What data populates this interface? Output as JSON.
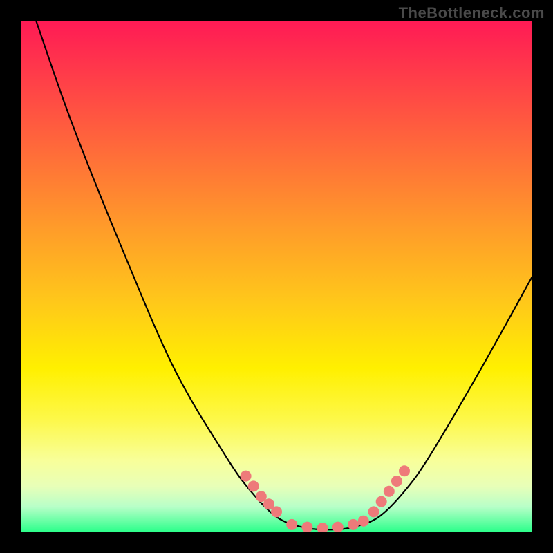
{
  "watermark": "TheBottleneck.com",
  "chart_data": {
    "type": "line",
    "title": "",
    "xlabel": "",
    "ylabel": "",
    "x_range": [
      0,
      100
    ],
    "y_range": [
      0,
      100
    ],
    "curve": {
      "name": "bottleneck-curve",
      "points": [
        {
          "x": 3,
          "y": 100
        },
        {
          "x": 10,
          "y": 80
        },
        {
          "x": 20,
          "y": 55
        },
        {
          "x": 30,
          "y": 32
        },
        {
          "x": 40,
          "y": 15
        },
        {
          "x": 45,
          "y": 8
        },
        {
          "x": 50,
          "y": 3
        },
        {
          "x": 55,
          "y": 1
        },
        {
          "x": 60,
          "y": 0.5
        },
        {
          "x": 65,
          "y": 1
        },
        {
          "x": 70,
          "y": 3
        },
        {
          "x": 75,
          "y": 8
        },
        {
          "x": 80,
          "y": 15
        },
        {
          "x": 90,
          "y": 32
        },
        {
          "x": 100,
          "y": 50
        }
      ]
    },
    "markers_left": [
      {
        "x": 44,
        "y": 11
      },
      {
        "x": 45.5,
        "y": 9
      },
      {
        "x": 47,
        "y": 7
      },
      {
        "x": 48.5,
        "y": 5.5
      },
      {
        "x": 50,
        "y": 4
      }
    ],
    "markers_bottom": [
      {
        "x": 53,
        "y": 1.5
      },
      {
        "x": 56,
        "y": 1
      },
      {
        "x": 59,
        "y": 0.8
      },
      {
        "x": 62,
        "y": 1
      },
      {
        "x": 65,
        "y": 1.5
      },
      {
        "x": 67,
        "y": 2.2
      }
    ],
    "markers_right": [
      {
        "x": 69,
        "y": 4
      },
      {
        "x": 70.5,
        "y": 6
      },
      {
        "x": 72,
        "y": 8
      },
      {
        "x": 73.5,
        "y": 10
      },
      {
        "x": 75,
        "y": 12
      }
    ],
    "marker_color": "#ee7a7a",
    "marker_radius": 8,
    "gradient_stops": [
      {
        "pos": 0,
        "color": "#ff1a55"
      },
      {
        "pos": 50,
        "color": "#ffc81a"
      },
      {
        "pos": 80,
        "color": "#fff000"
      },
      {
        "pos": 100,
        "color": "#2aff8a"
      }
    ]
  }
}
